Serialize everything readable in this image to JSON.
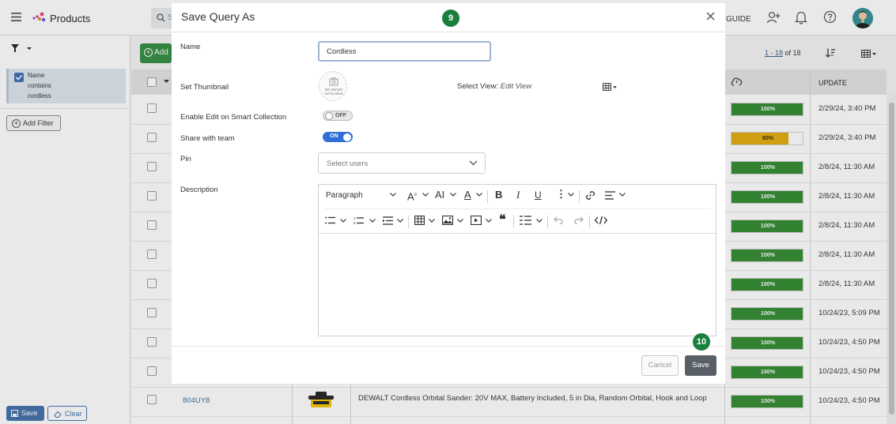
{
  "app": {
    "title": "Products",
    "search_placeholder": "S",
    "guide_label": "GUIDE"
  },
  "left_panel": {
    "filter_lines": [
      "Name",
      "contains",
      "cordless"
    ],
    "add_filter_label": "Add Filter",
    "save_label": "Save",
    "clear_label": "Clear"
  },
  "toolbar": {
    "add_label": "Add",
    "pager_range": "1 - 18",
    "pager_of": "of 18"
  },
  "grid": {
    "update_header": "UPDATE",
    "rows": [
      {
        "progress_label": "100%",
        "progress_value": 100,
        "update": "2/29/24, 3:40 PM"
      },
      {
        "progress_label": "80%",
        "progress_value": 80,
        "update": "2/29/24, 3:40 PM"
      },
      {
        "progress_label": "100%",
        "progress_value": 100,
        "update": "2/8/24, 11:30 AM"
      },
      {
        "progress_label": "100%",
        "progress_value": 100,
        "update": "2/8/24, 11:30 AM"
      },
      {
        "progress_label": "100%",
        "progress_value": 100,
        "update": "2/8/24, 11:30 AM"
      },
      {
        "progress_label": "100%",
        "progress_value": 100,
        "update": "2/8/24, 11:30 AM"
      },
      {
        "progress_label": "100%",
        "progress_value": 100,
        "update": "2/8/24, 11:30 AM"
      },
      {
        "progress_label": "100%",
        "progress_value": 100,
        "update": "10/24/23, 5:09 PM"
      },
      {
        "progress_label": "100%",
        "progress_value": 100,
        "update": "10/24/23, 4:50 PM"
      },
      {
        "progress_label": "100%",
        "progress_value": 100,
        "update": "10/24/23, 4:50 PM"
      },
      {
        "progress_label": "100%",
        "progress_value": 100,
        "update": "10/24/23, 4:50 PM"
      }
    ],
    "visible_product": {
      "sku": "804UY8",
      "description": "DEWALT Cordless Orbital Sander: 20V MAX, Battery Included, 5 in Dia, Random Orbital, Hook and Loop"
    }
  },
  "modal": {
    "title": "Save Query As",
    "name_label": "Name",
    "name_value": "Cordless",
    "thumbnail_label": "Set Thumbnail",
    "no_image_text": "NO IMAGE AVAILABLE",
    "select_view_label": "Select View:",
    "select_view_link": "Edit View",
    "smart_collection_label": "Enable Edit on Smart Collection",
    "smart_collection_state": "OFF",
    "share_label": "Share with team",
    "share_state": "ON",
    "pin_label": "Pin",
    "pin_placeholder": "Select users",
    "description_label": "Description",
    "editor": {
      "paragraph_label": "Paragraph"
    },
    "cancel_label": "Cancel",
    "save_label": "Save"
  },
  "steps": {
    "step_a": "9",
    "step_b": "10"
  },
  "colors": {
    "accent_green": "#2e8b3e",
    "step_green": "#1a7f3c",
    "progress_green": "#2f8a2f",
    "progress_warn": "#e2aa0c",
    "primary_blue": "#3f6ea8"
  }
}
